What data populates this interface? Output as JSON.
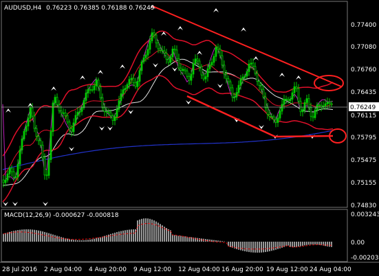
{
  "main": {
    "symbol": "AUDUSD,H4",
    "ohlc": "0.76223 0.76385 0.76188 0.76249",
    "price_labels": [
      "0.77400",
      "0.77080",
      "0.76760",
      "0.76435",
      "0.76115",
      "0.75795",
      "0.75475",
      "0.75155",
      "0.74830"
    ],
    "current_price": "0.76249",
    "colors": {
      "background": "#000000",
      "grid": "#787878",
      "candle": "#00cc00",
      "bollinger": "#e0102a",
      "ma_white": "#e6e6e6",
      "ma_blue": "#2233cc",
      "ma_magenta": "#c020c0",
      "annotation": "#ff2020",
      "current_price_box": "#ffffff"
    }
  },
  "macd": {
    "label": "MACD(12,26,9) -0.000627 -0.000818",
    "price_labels": [
      "0.003243",
      "0.00",
      "-0.002035"
    ],
    "colors": {
      "histogram": "#ffffff",
      "signal": "#e01010"
    }
  },
  "time_axis": {
    "labels": [
      "28 Jul 2016",
      "2 Aug 04:00",
      "4 Aug 20:00",
      "9 Aug 12:00",
      "12 Aug 04:00",
      "16 Aug 20:00",
      "19 Aug 12:00",
      "24 Aug 04:00"
    ]
  }
}
